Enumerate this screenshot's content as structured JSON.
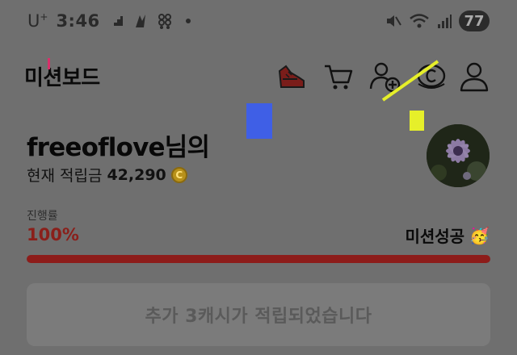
{
  "status_bar": {
    "carrier": "U",
    "carrier_sup": "+",
    "time": "3:46",
    "battery": "77",
    "icons": [
      "steps-icon",
      "activity-icon",
      "grid-app-icon",
      "notification-dot",
      "mute-icon",
      "wifi-icon",
      "signal-icon"
    ]
  },
  "header": {
    "title": "미션보드",
    "icons": [
      "sneaker-icon",
      "cart-icon",
      "add-friend-icon",
      "coin-icon",
      "profile-icon"
    ]
  },
  "user": {
    "name": "freeoflove님의",
    "points_label": "현재 적립금",
    "points_value": "42,290",
    "coin_symbol": "C"
  },
  "progress": {
    "label": "진행률",
    "value_text": "100%",
    "fraction": 1.0,
    "status": "미션성공",
    "status_emoji": "🥳"
  },
  "notice": {
    "text": "추가 3캐시가 적립되었습니다"
  },
  "colors": {
    "background": "#6f6f6f",
    "progress_fill": "#8d1c1a",
    "annotation_blue": "#3f5fe6",
    "annotation_yellow": "#e6ef2a",
    "annotation_pink": "#d8306a"
  }
}
